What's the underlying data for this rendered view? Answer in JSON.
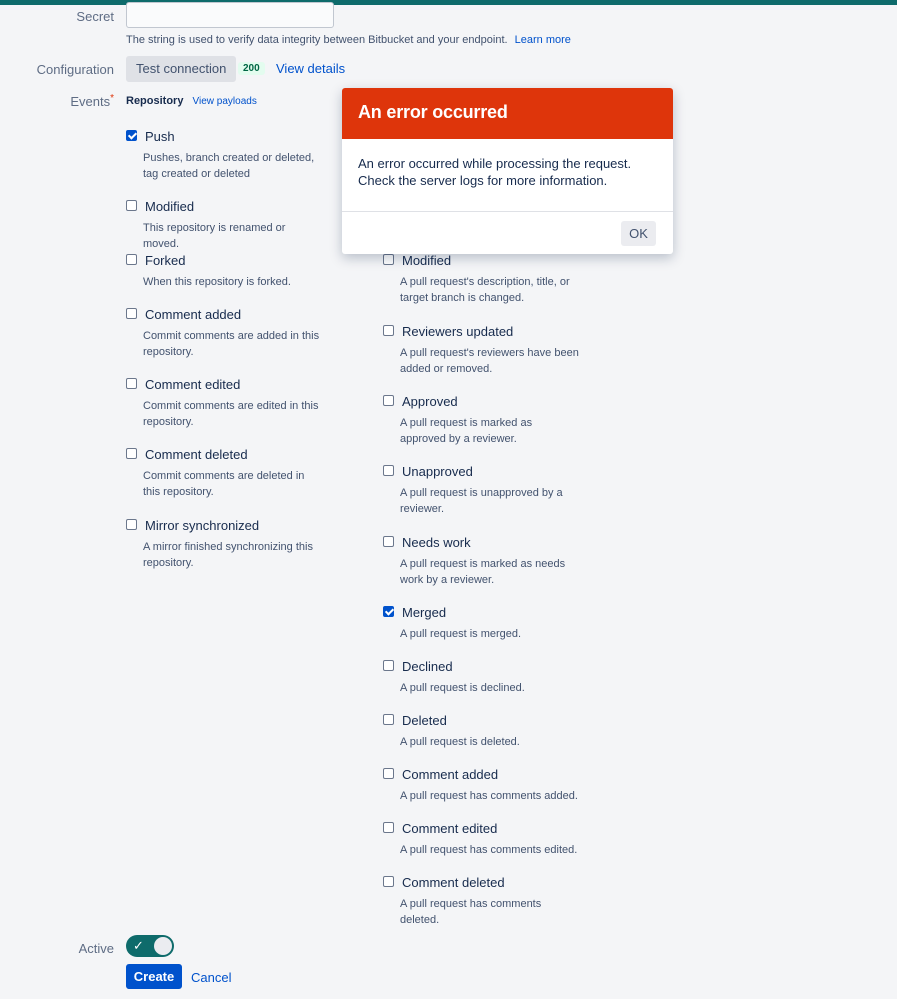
{
  "form": {
    "secret_label": "Secret",
    "secret_value": "",
    "secret_help": "The string is used to verify data integrity between Bitbucket and your endpoint.",
    "learn_more": "Learn more",
    "configuration_label": "Configuration",
    "test_connection": "Test connection",
    "status_code": "200",
    "view_details": "View details",
    "events_label": "Events",
    "required_marker": "*",
    "repository_heading": "Repository",
    "view_payloads": "View payloads",
    "active_label": "Active",
    "active_checkmark": "✓",
    "active_on": true,
    "create_button": "Create",
    "cancel_link": "Cancel"
  },
  "repository_events": [
    {
      "title": "Push",
      "desc": "Pushes, branch created or deleted, tag created or deleted",
      "checked": true
    },
    {
      "title": "Modified",
      "desc": "This repository is renamed or moved.",
      "checked": false
    },
    {
      "title": "Forked",
      "desc": "When this repository is forked.",
      "checked": false
    },
    {
      "title": "Comment added",
      "desc": "Commit comments are added in this repository.",
      "checked": false
    },
    {
      "title": "Comment edited",
      "desc": "Commit comments are edited in this repository.",
      "checked": false
    },
    {
      "title": "Comment deleted",
      "desc": "Commit comments are deleted in this repository.",
      "checked": false
    },
    {
      "title": "Mirror synchronized",
      "desc": "A mirror finished synchronizing this repository.",
      "checked": false
    }
  ],
  "pull_request_events": [
    {
      "title": "Modified",
      "desc": "A pull request's description, title, or target branch is changed.",
      "checked": false
    },
    {
      "title": "Reviewers updated",
      "desc": "A pull request's reviewers have been added or removed.",
      "checked": false
    },
    {
      "title": "Approved",
      "desc": "A pull request is marked as approved by a reviewer.",
      "checked": false
    },
    {
      "title": "Unapproved",
      "desc": "A pull request is unapproved by a reviewer.",
      "checked": false
    },
    {
      "title": "Needs work",
      "desc": "A pull request is marked as needs work by a reviewer.",
      "checked": false
    },
    {
      "title": "Merged",
      "desc": "A pull request is merged.",
      "checked": true
    },
    {
      "title": "Declined",
      "desc": "A pull request is declined.",
      "checked": false
    },
    {
      "title": "Deleted",
      "desc": "A pull request is deleted.",
      "checked": false
    },
    {
      "title": "Comment added",
      "desc": "A pull request has comments added.",
      "checked": false
    },
    {
      "title": "Comment edited",
      "desc": "A pull request has comments edited.",
      "checked": false
    },
    {
      "title": "Comment deleted",
      "desc": "A pull request has comments deleted.",
      "checked": false
    }
  ],
  "dialog": {
    "title": "An error occurred",
    "message": "An error occurred while processing the request. Check the server logs for more information.",
    "ok_button": "OK"
  },
  "colors": {
    "dialog_header": "#de350b",
    "primary": "#0052cc",
    "toggle_on": "#0e6b6b",
    "top_bar": "#0e6b6b"
  }
}
